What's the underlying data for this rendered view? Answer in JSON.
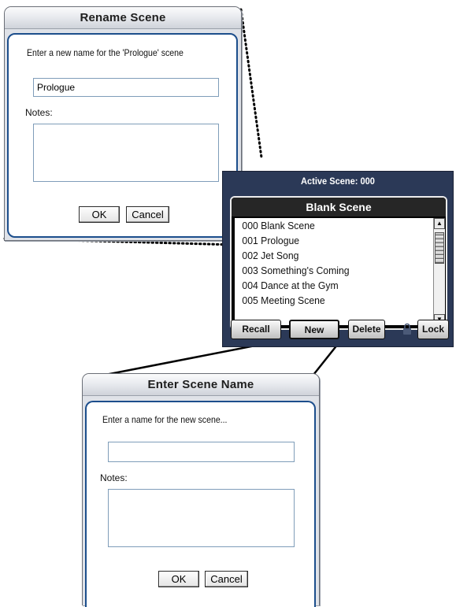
{
  "rename_dialog": {
    "title": "Rename Scene",
    "prompt": "Enter a new name for the 'Prologue' scene",
    "name_value": "Prologue",
    "notes_label": "Notes:",
    "ok_label": "OK",
    "cancel_label": "Cancel"
  },
  "scene_panel": {
    "active_scene": "Active Scene: 000",
    "header": "Blank Scene",
    "scenes": [
      "000 Blank Scene",
      "001 Prologue",
      "002 Jet Song",
      "003 Something's Coming",
      "004 Dance at the Gym",
      "005 Meeting Scene"
    ],
    "buttons": {
      "recall": "Recall",
      "new": "New",
      "delete": "Delete",
      "lock": "Lock"
    },
    "icons": {
      "scroll_up": "up-arrow-icon",
      "scroll_down": "down-arrow-icon",
      "lock": "padlock-icon"
    }
  },
  "enter_dialog": {
    "title": "Enter Scene Name",
    "prompt": "Enter a name for the new scene...",
    "name_value": "",
    "notes_label": "Notes:",
    "ok_label": "OK",
    "cancel_label": "Cancel"
  },
  "colors": {
    "panel_bg": "#2b3957",
    "dialog_border": "#1c4e8c",
    "dialog_bg": "#dfe2e8"
  }
}
